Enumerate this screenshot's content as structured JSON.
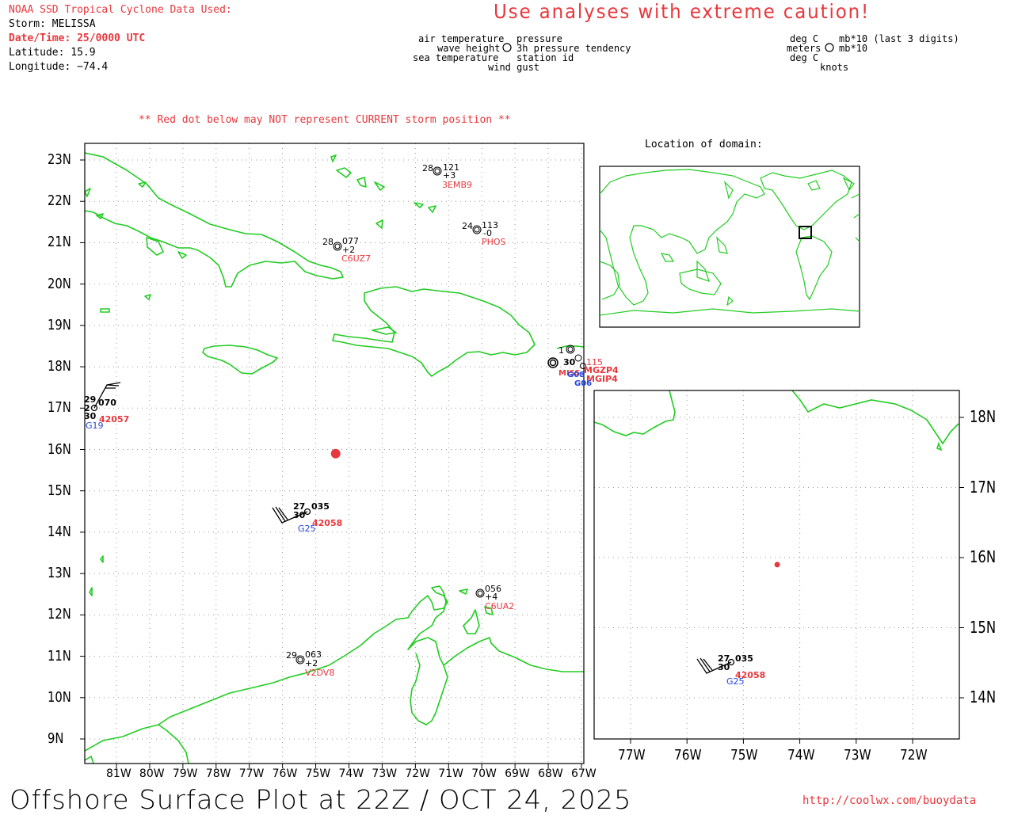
{
  "header": {
    "source_line": "NOAA SSD Tropical Cyclone Data Used:",
    "storm_line": "Storm: MELISSA",
    "datetime_line": "Date/Time: 25/0000 UTC",
    "latitude_line": "Latitude: 15.9",
    "longitude_line": "Longitude: −74.4",
    "caution": "Use analyses with extreme caution!"
  },
  "legend": {
    "left": [
      "air temperature",
      "wave height",
      "sea temperature",
      "wind gust"
    ],
    "right": [
      "pressure",
      "3h pressure tendency",
      "station id"
    ],
    "units_left": [
      "deg C",
      "meters",
      "deg C"
    ],
    "units_right": [
      "mb*10 (last 3 digits)",
      "mb*10",
      "knots"
    ]
  },
  "notes": {
    "red_dot_warning": "** Red dot below may NOT represent CURRENT storm position **",
    "location_title": "Location of domain:"
  },
  "main_map": {
    "lat_labels": [
      "23N",
      "22N",
      "21N",
      "20N",
      "19N",
      "18N",
      "17N",
      "16N",
      "15N",
      "14N",
      "13N",
      "12N",
      "11N",
      "10N",
      "9N"
    ],
    "lon_labels": [
      "81W",
      "80W",
      "79W",
      "78W",
      "77W",
      "76W",
      "75W",
      "74W",
      "73W",
      "72W",
      "71W",
      "70W",
      "69W",
      "68W",
      "67W"
    ],
    "storm_position": {
      "lat": 15.9,
      "lon": -74.4,
      "color": "#e8383d"
    },
    "stations": [
      {
        "id": "3EMB9",
        "air": "28",
        "pressure": "121",
        "tendency": "+3",
        "lat": 22.7,
        "lon": -71.4
      },
      {
        "id": "PHOS",
        "air": "24",
        "pressure": "113",
        "tendency": "-0",
        "lat": 21.3,
        "lon": -70.1
      },
      {
        "id": "C6UZ7",
        "air": "28",
        "pressure": "077",
        "tendency": "+2",
        "lat": 20.9,
        "lon": -74.1
      },
      {
        "id": "42057",
        "id_color": "#e8383d",
        "air": "29",
        "sea": "30",
        "wave": "2",
        "pressure": "070",
        "gust": "G19",
        "lat": 17.0,
        "lon": -81.4
      },
      {
        "id": "42058",
        "id_color": "#e8383d",
        "air": "27",
        "sea": "30",
        "pressure": "035",
        "gust": "G25",
        "lat": 14.5,
        "lon": -75.0
      },
      {
        "id": "C6UA2",
        "air": "",
        "pressure": "056",
        "tendency": "+4",
        "lat": 12.5,
        "lon": -70.0
      },
      {
        "id": "V2DV8",
        "air": "29",
        "pressure": "063",
        "tendency": "+2",
        "lat": 10.9,
        "lon": -75.4
      },
      {
        "id": "MGZP4",
        "id_color": "#e8383d",
        "pressure": "115",
        "lat": 18.1,
        "lon": -67.1
      },
      {
        "id": "MGIP4",
        "id_color": "#e8383d",
        "gust": "G06",
        "lat": 17.9,
        "lon": -67.1
      }
    ],
    "east_edge_cluster": {
      "values": [
        "1",
        "30",
        "115",
        "30"
      ],
      "ids": [
        "MISS",
        "G08",
        "G06"
      ]
    }
  },
  "zoom_map": {
    "lat_labels": [
      "18N",
      "17N",
      "16N",
      "15N",
      "14N"
    ],
    "lon_labels": [
      "77W",
      "76W",
      "75W",
      "74W",
      "73W",
      "72W"
    ],
    "station": {
      "id": "42058",
      "air": "27",
      "sea": "30",
      "pressure": "035",
      "gust": "G25"
    }
  },
  "footer": {
    "title": "Offshore Surface Plot at 22Z / OCT 24, 2025",
    "url": "http://coolwx.com/buoydata"
  },
  "colors": {
    "coast": "#22cc22",
    "accent_red": "#e8383d",
    "blue": "#2244dd",
    "grid": "#999999"
  }
}
